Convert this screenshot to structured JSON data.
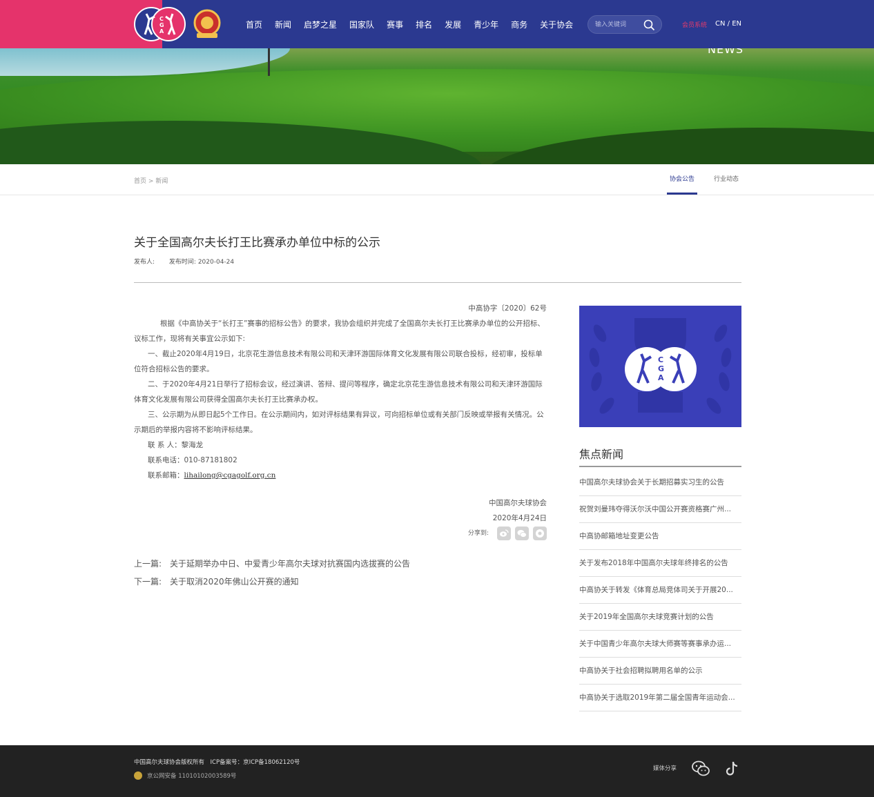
{
  "header": {
    "nav": [
      "首页",
      "新闻",
      "启梦之星",
      "国家队",
      "赛事",
      "排名",
      "发展",
      "青少年",
      "商务",
      "关于协会"
    ],
    "search_placeholder": "输入关键词",
    "member_label": "会员系统",
    "lang_label": "CN / EN"
  },
  "banner": {
    "label": "NEWS"
  },
  "breadcrumb": {
    "home": "首页",
    "sep": ">",
    "current": "新闻"
  },
  "tabs": [
    {
      "label": "协会公告",
      "active": true
    },
    {
      "label": "行业动态",
      "active": false
    }
  ],
  "article": {
    "title": "关于全国高尔夫长打王比赛承办单位中标的公示",
    "author_label": "发布人:",
    "date_label": "发布时间: 2020-04-24",
    "doc_no": "中高协字〔2020〕62号",
    "para1": "根据《中高协关于“长打王”赛事的招标公告》的要求，我协会组织并完成了全国高尔夫长打王比赛承办单位的公开招标、议标工作，现将有关事宜公示如下:",
    "para2": "一、截止2020年4月19日，北京花生游信息技术有限公司和天津环游国际体育文化发展有限公司联合投标，经初审，投标单位符合招标公告的要求。",
    "para3": "二、于2020年4月21日举行了招标会议，经过演讲、答辩、提问等程序，确定北京花生游信息技术有限公司和天津环游国际体育文化发展有限公司获得全国高尔夫长打王比赛承办权。",
    "para4": "三、公示期为从即日起5个工作日。在公示期间内，如对评标结果有异议，可向招标单位或有关部门反映或举报有关情况。公示期后的举报内容将不影响评标结果。",
    "contact_person": "联 系 人：黎海龙",
    "contact_phone": "联系电话：010-87181802",
    "contact_email_label": "联系邮箱：",
    "contact_email": "lihailong@cgagolf.org.cn",
    "sign_org": "中国高尔夫球协会",
    "sign_date": "2020年4月24日",
    "share_label": "分享到:"
  },
  "prevnext": {
    "prev_key": "上一篇:",
    "prev_title": "关于延期举办中日、中爱青少年高尔夫球对抗赛国内选拔赛的公告",
    "next_key": "下一篇:",
    "next_title": "关于取消2020年佛山公开赛的通知"
  },
  "sidebar": {
    "title": "焦点新闻",
    "items": [
      "中国高尔夫球协会关于长期招募实习生的公告",
      "祝贺刘曼玮夺得沃尔沃中国公开赛资格赛广州...",
      "中高协邮箱地址变更公告",
      "关于发布2018年中国高尔夫球年终排名的公告",
      "中高协关于转发《体育总局竞体司关于开展20...",
      "关于2019年全国高尔夫球竞赛计划的公告",
      "关于中国青少年高尔夫球大师赛等赛事承办运...",
      "中高协关于社会招聘拟聘用名单的公示",
      "中高协关于选取2019年第二届全国青年运动会..."
    ]
  },
  "footer": {
    "copyright": "中国高尔夫球协会版权所有　ICP备案号：京ICP备18062120号",
    "police": "京公网安备 11010102003589号",
    "share_label": "媒体分享"
  },
  "colors": {
    "navy": "#2b3990",
    "pink": "#e5336b",
    "footer": "#222222"
  }
}
